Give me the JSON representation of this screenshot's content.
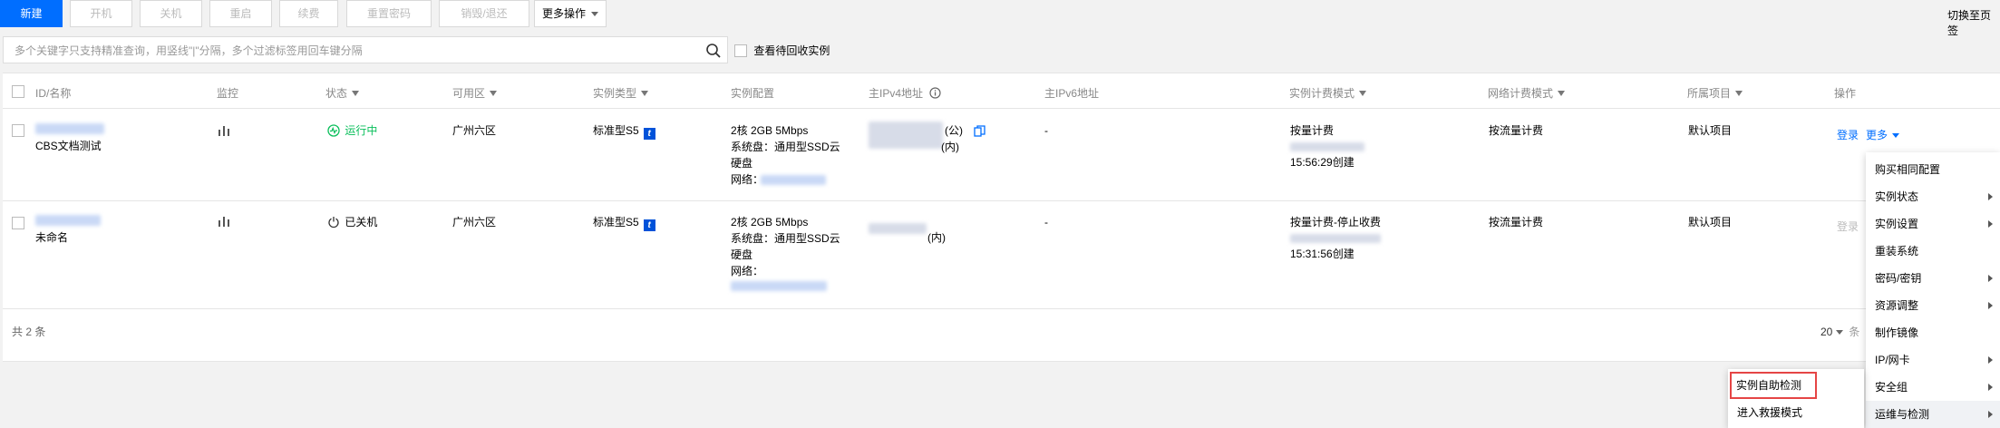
{
  "toolbar": {
    "new": "新建",
    "start": "开机",
    "shutdown": "关机",
    "restart": "重启",
    "renew": "续费",
    "reset_password": "重置密码",
    "terminate": "销毁/退还",
    "more": "更多操作",
    "switch_page": "切换至页签"
  },
  "search": {
    "placeholder": "多个关键字只支持精准查询，用竖线\"|\"分隔，多个过滤标签用回车键分隔",
    "recycle_label": "查看待回收实例"
  },
  "table": {
    "headers": {
      "id_name": "ID/名称",
      "monitor": "监控",
      "status": "状态",
      "zone": "可用区",
      "type": "实例类型",
      "config": "实例配置",
      "ipv4": "主IPv4地址",
      "ipv6": "主IPv6地址",
      "billing": "实例计费模式",
      "net_billing": "网络计费模式",
      "project": "所属项目",
      "ops": "操作"
    },
    "rows": [
      {
        "name": "CBS文档测试",
        "status": "运行中",
        "zone": "广州六区",
        "type": "标准型S5",
        "type_badge": "t",
        "config_line1": "2核 2GB 5Mbps",
        "config_line2": "系统盘：通用型SSD云",
        "config_line3": "硬盘",
        "config_line4": "网络：",
        "ipv4_public_tag": "(公)",
        "ipv4_private_tag": "(内)",
        "ipv6": "-",
        "billing": "按量计费",
        "created": "15:56:29创建",
        "net_billing": "按流量计费",
        "project": "默认项目",
        "login": "登录",
        "more": "更多"
      },
      {
        "name": "未命名",
        "status": "已关机",
        "zone": "广州六区",
        "type": "标准型S5",
        "type_badge": "t",
        "config_line1": "2核 2GB 5Mbps",
        "config_line2": "系统盘：通用型SSD云",
        "config_line3": "硬盘",
        "config_line4": "网络：",
        "ipv4_private_tag": "(内)",
        "ipv6": "-",
        "billing": "按量计费-停止收费",
        "created": "15:31:56创建",
        "net_billing": "按流量计费",
        "project": "默认项目",
        "login": "登录"
      }
    ]
  },
  "footer": {
    "total": "共 2 条",
    "page_size": "20",
    "page_size_suffix": "条"
  },
  "more_menu": [
    {
      "label": "购买相同配置",
      "submenu": false
    },
    {
      "label": "实例状态",
      "submenu": true
    },
    {
      "label": "实例设置",
      "submenu": true
    },
    {
      "label": "重装系统",
      "submenu": false
    },
    {
      "label": "密码/密钥",
      "submenu": true
    },
    {
      "label": "资源调整",
      "submenu": true
    },
    {
      "label": "制作镜像",
      "submenu": false
    },
    {
      "label": "IP/网卡",
      "submenu": true
    },
    {
      "label": "安全组",
      "submenu": true
    },
    {
      "label": "运维与检测",
      "submenu": true
    }
  ],
  "ops_submenu": [
    {
      "label": "实例自助检测",
      "highlighted": true
    },
    {
      "label": "进入救援模式",
      "highlighted": false
    }
  ],
  "colors": {
    "primary": "#006eff",
    "running": "#0abf5b",
    "highlight_border": "#e54545",
    "badge": "#0052d9"
  }
}
